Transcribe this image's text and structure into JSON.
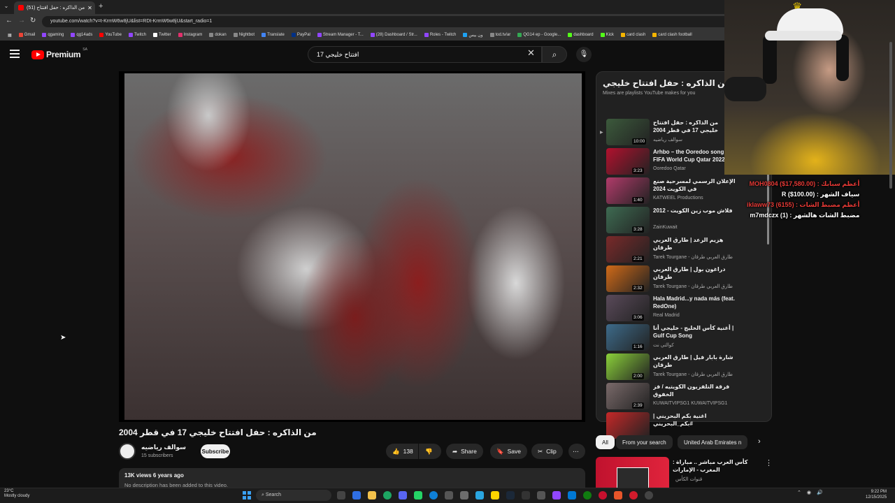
{
  "browser": {
    "tab_title": "(51) من الذاكره : حفل افتتاح",
    "url": "youtube.com/watch?v=t-KrmW6w8jU&list=RDt-KrmW6w8jU&start_radio=1",
    "bookmarks": [
      "Gmail",
      "qgaming",
      "qg14ads",
      "YouTube",
      "Twitch",
      "Twitter",
      "Instagram",
      "dokan",
      "Nightbot",
      "Translate",
      "PayPal",
      "Stream Manager - T...",
      "(28) Dashboard / Str...",
      "Roles - Twitch",
      "ون بيس",
      "tod.tv/ar",
      "QG14 ep - Google...",
      "dashboard",
      "Kick",
      "card clash",
      "card clash football"
    ]
  },
  "yt": {
    "logo": "Premium",
    "region": "SA",
    "search_value": "افتتاح خليجي 17",
    "video_title": "من الذاكره : حفل افتتاح خليجي 17 في قطر 2004",
    "channel": "سوالف رياضيه",
    "subs": "15 subscribers",
    "subscribe": "Subscribe",
    "likes": "138",
    "share": "Share",
    "save": "Save",
    "clip": "Clip",
    "meta": "13K views  6 years ago",
    "desc": "No description has been added to this video."
  },
  "playlist": {
    "title": "Mix - من الذاكره : حفل افتتاح خليجي",
    "subtitle": "Mixes are playlists YouTube makes for you",
    "items": [
      {
        "title": "من الذاكره : حفل افتتاح خليجي 17 في قطر 2004",
        "channel": "سوالف رياضيه",
        "dur": "10:00"
      },
      {
        "title": "Arhbo – the Ooredoo song for FIFA World Cup Qatar 2022",
        "channel": "Ooredoo Qatar",
        "dur": "3:23"
      },
      {
        "title": "الإعلان الرسمي لمسرحية صنع في الكويت 2024",
        "channel": "KATWEEL Productions",
        "dur": "1:40"
      },
      {
        "title": "فلاش موب زين الكويت - 2012",
        "channel": "ZainKuwait",
        "dur": "3:28"
      },
      {
        "title": "هزيم الرعد | طارق العربي طرقان",
        "channel": "Tarek Tourgane - طارق العربي طرقان",
        "dur": "2:21"
      },
      {
        "title": "دراغون بول | طارق العربي طرقان",
        "channel": "Tarek Tourgane - طارق العربي طرقان",
        "dur": "2:32"
      },
      {
        "title": "Hala Madrid...y nada más (feat. RedOne)",
        "channel": "Real Madrid",
        "dur": "3:06"
      },
      {
        "title": "أغنية كأس الخليج - خليجي أنا | Gulf Cup Song",
        "channel": "كوالتي نت",
        "dur": "1:16"
      },
      {
        "title": "شارة بابار فيل | طارق العربي طرقان",
        "channel": "Tarek Tourgane - طارق العربي طرقان",
        "dur": "2:00"
      },
      {
        "title": "فرقة التلفزيون الكويتيه / فز الخفوق",
        "channel": "KUWAITVIPSG1 KUWAITVIPSG1",
        "dur": "2:39"
      },
      {
        "title": "اغنية بكم البحريني | #بكم_البحريني",
        "channel": "",
        "dur": ""
      }
    ],
    "chips": [
      "All",
      "From your search",
      "United Arab Emirates n"
    ],
    "rec_title": "كأس العرب مباشر .. مباراة : المغرب - الإمارات",
    "rec_channel": "قنوات الكأس"
  },
  "overlay": {
    "line1": "أعظم سبابك : MOH0804 ($17,580.00)",
    "line2": "سياف الشهر : R ($100.00)",
    "line3": "أعظم مضبط الشات : (6155) iklaww73",
    "line4": "مضبط الشات هالشهر : (1) m7mdczx"
  },
  "taskbar": {
    "temp": "23°C",
    "weather": "Mostly cloudy",
    "search": "Search",
    "time": "9:22 PM",
    "date": "12/15/2025"
  },
  "colors": {
    "accent": "#ff0000",
    "chip_active": "#f1f1f1"
  }
}
